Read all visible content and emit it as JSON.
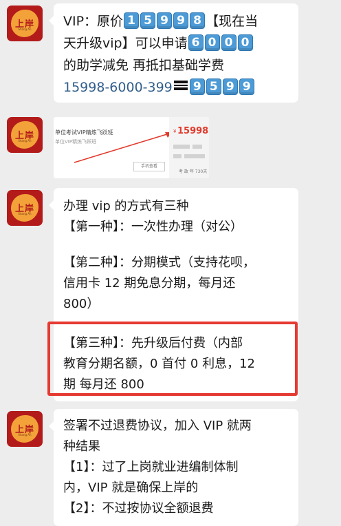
{
  "avatar": {
    "name": "上岸",
    "sub": "Shang An"
  },
  "messages": [
    {
      "lines": [
        "VIP：原价",
        "【现在当",
        "天升级vip】可以申请",
        "的助学减免 再抵扣基础学费",
        "15998-6000-399"
      ],
      "keys_price": [
        "1",
        "5",
        "9",
        "9",
        "8"
      ],
      "keys_discount": [
        "6",
        "0",
        "0",
        "0"
      ],
      "keys_result": [
        "9",
        "5",
        "9",
        "9"
      ]
    },
    {
      "card": {
        "title": "单位考试VIP精炼飞跃班",
        "subtitle": "单位VIP精炼飞跃班",
        "button": "手机查看",
        "price_prefix": "¥",
        "price": "15998.00",
        "exam_label": "考 政 年",
        "exam_value": "730天"
      }
    },
    {
      "lines": [
        "办理 vip 的方式有三种",
        "【第一种】：一次性办理（对公）",
        "【第二种】：分期模式（支持花呗，",
        "信用卡 12 期免息分期，每月还",
        "800）",
        "【第三种】：先升级后付费（内部",
        "教育分期名额，0 首付 0 利息，12",
        "期 每月还 800"
      ]
    },
    {
      "lines": [
        "签署不过退费协议，加入 VIP 就两",
        "种结果",
        "【1】：过了上岗就业进编制体制",
        "内，VIP 就是确保上岸的",
        "【2】：不过按协议全额退费"
      ]
    }
  ],
  "colors": {
    "highlight_border": "#e53a32",
    "key_bg": "#4d9bd6",
    "phone_text": "#315e8a"
  }
}
